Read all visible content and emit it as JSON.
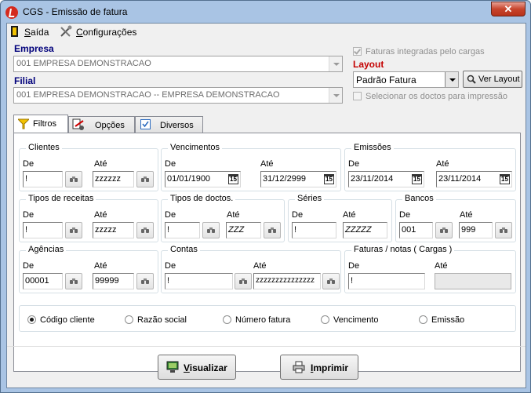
{
  "window": {
    "title": "CGS - Emissão de fatura",
    "close_glyph": "✕"
  },
  "menu": {
    "items": [
      {
        "accel": "S",
        "rest": "aída",
        "icon": "exit-door-icon"
      },
      {
        "accel": "C",
        "rest": "onfigurações",
        "icon": "tools-icon"
      }
    ]
  },
  "empresa": {
    "label": "Empresa",
    "value": "001 EMPRESA DEMONSTRACAO"
  },
  "filial": {
    "label": "Filial",
    "value": "001 EMPRESA DEMONSTRACAO -- EMPRESA DEMONSTRACAO"
  },
  "faturas_integradas": {
    "label": "Faturas integradas pelo cargas",
    "checked": true
  },
  "layout": {
    "label": "Layout",
    "value": "Padrão Fatura",
    "button": "Ver Layout"
  },
  "selecionar_doctos": {
    "label": "Selecionar os doctos para impressão",
    "checked": false
  },
  "tabs": [
    {
      "label": "Filtros",
      "icon": "funnel-icon"
    },
    {
      "label": "Opções",
      "icon": "options-icon"
    },
    {
      "label": "Diversos",
      "icon": "checkbox-icon"
    }
  ],
  "common": {
    "de": "De",
    "ate": "Até"
  },
  "filters": {
    "clientes": {
      "title": "Clientes",
      "de": "!",
      "ate": "zzzzzz"
    },
    "vencimentos": {
      "title": "Vencimentos",
      "de": "01/01/1900",
      "ate": "31/12/2999"
    },
    "emissoes": {
      "title": "Emissões",
      "de": "23/11/2014",
      "ate": "23/11/2014"
    },
    "tipos_receitas": {
      "title": "Tipos de receitas",
      "de": "!",
      "ate": "zzzzz"
    },
    "tipos_doctos": {
      "title": "Tipos de doctos.",
      "de": "!",
      "ate": "ZZZ"
    },
    "series": {
      "title": "Séries",
      "de": "!",
      "ate": "ZZZZZ"
    },
    "bancos": {
      "title": "Bancos",
      "de": "001",
      "ate": "999"
    },
    "agencias": {
      "title": "Agências",
      "de": "00001",
      "ate": "99999"
    },
    "contas": {
      "title": "Contas",
      "de": "!",
      "ate": "zzzzzzzzzzzzzzz"
    },
    "faturas_notas": {
      "title": "Faturas / notas ( Cargas )",
      "de": "!",
      "ate": ""
    }
  },
  "calendar_glyph": "15",
  "order": {
    "options": [
      "Código cliente",
      "Razão social",
      "Número fatura",
      "Vencimento",
      "Emissão"
    ],
    "selected": 0
  },
  "buttons": {
    "visualizar": {
      "accel": "V",
      "rest": "isualizar"
    },
    "imprimir": {
      "accel": "I",
      "rest": "mprimir"
    }
  }
}
